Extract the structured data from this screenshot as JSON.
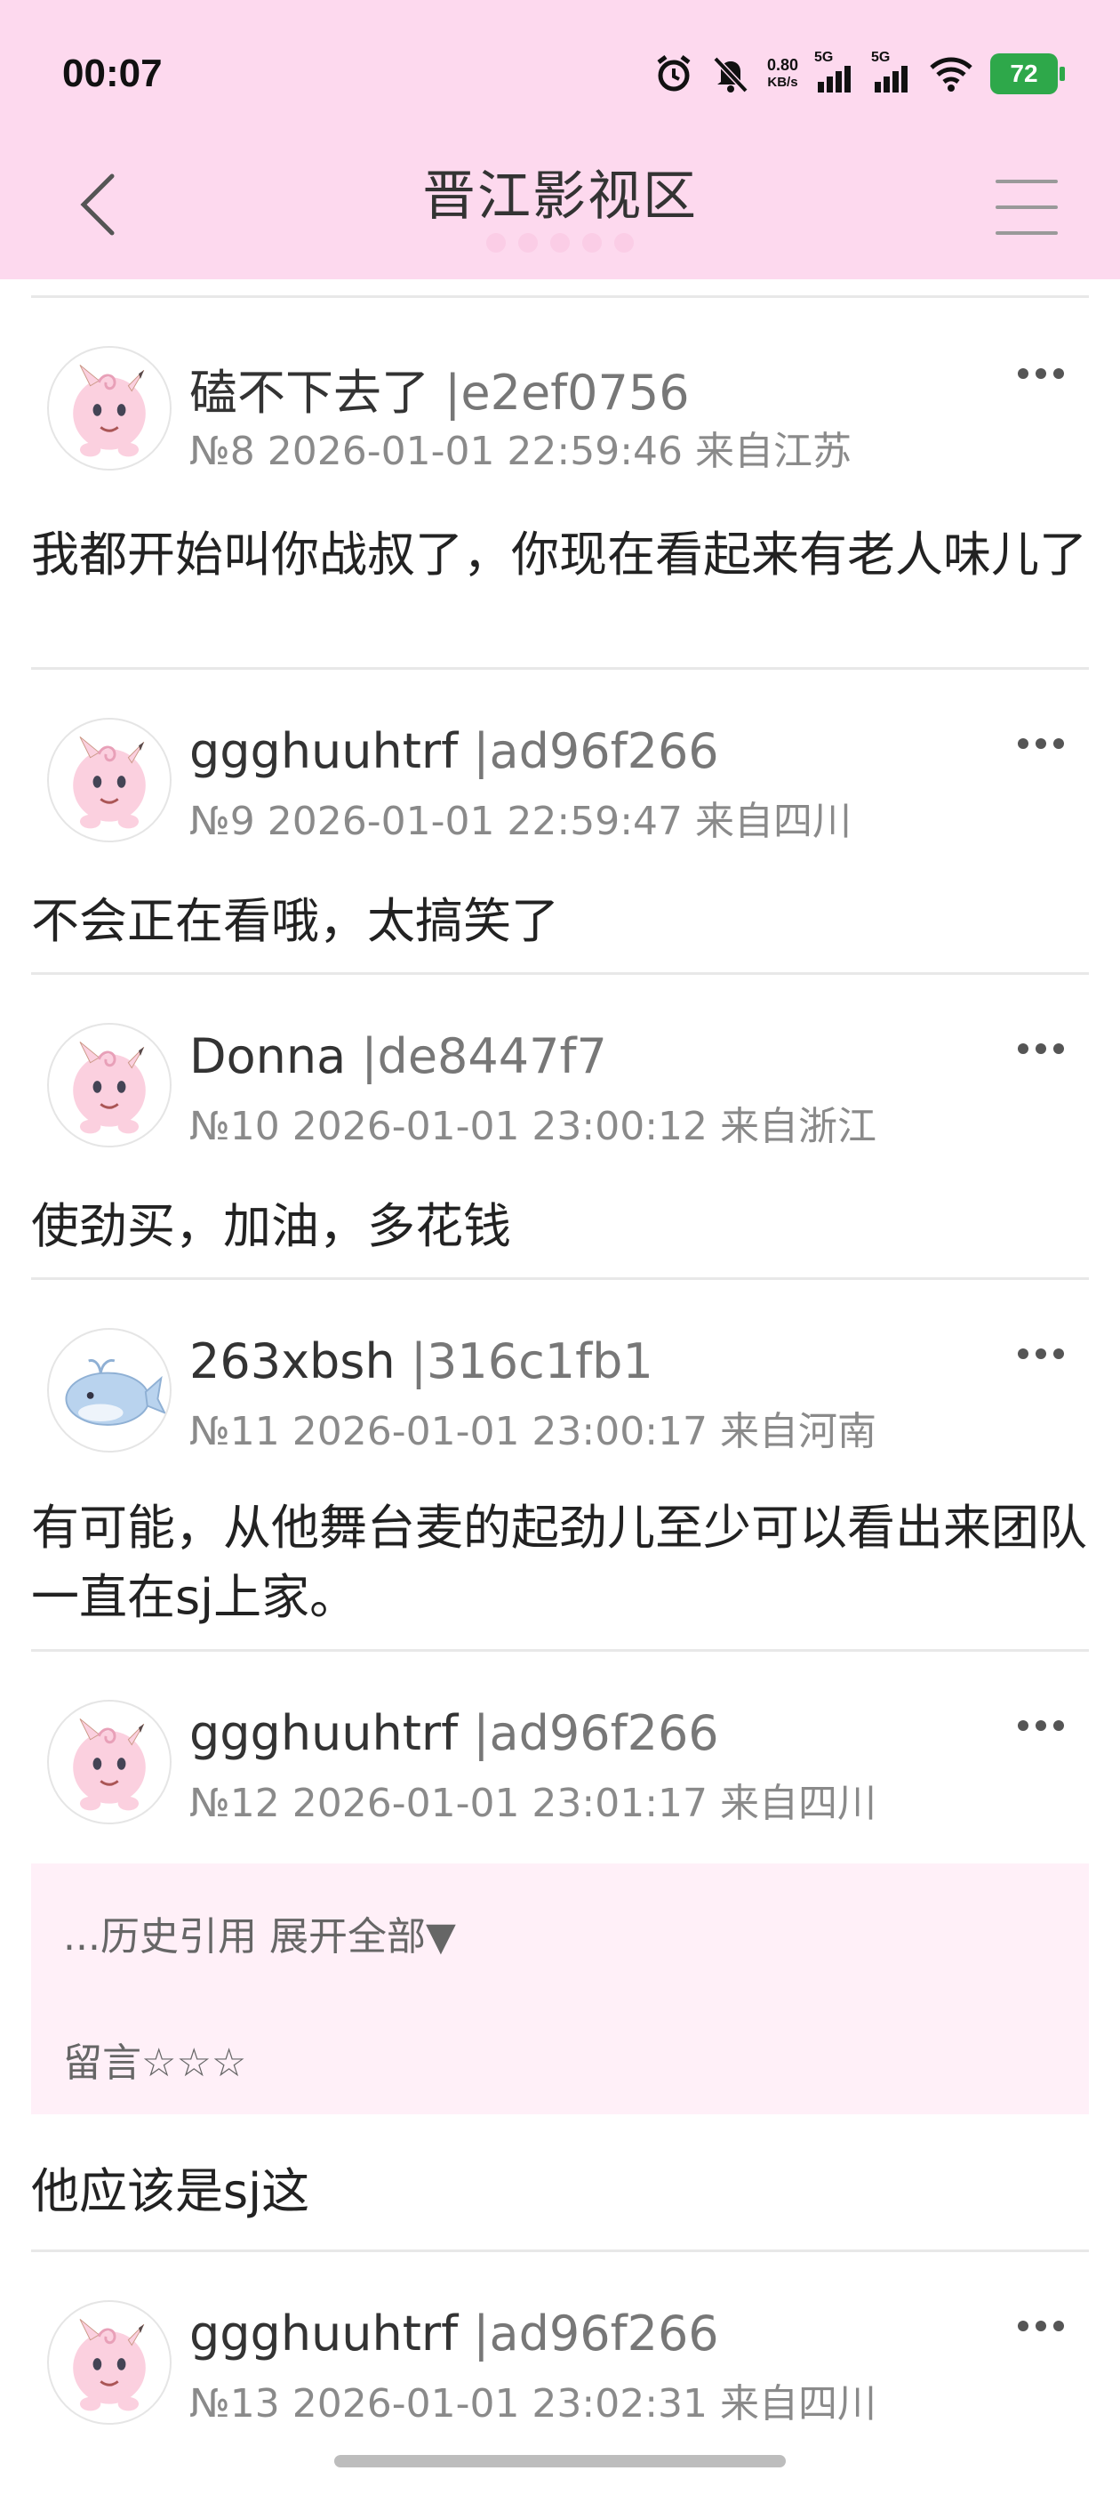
{
  "status_bar": {
    "time": "00:07",
    "net_speed_value": "0.80",
    "net_speed_unit": "KB/s",
    "sim1": "5G",
    "sim2": "5G",
    "battery": "72"
  },
  "header": {
    "title": "晋江影视区"
  },
  "posts": [
    {
      "name": "磕不下去了",
      "uid": "|e2ef0756",
      "meta": "№8 2026-01-01 22:59:46 来自江苏",
      "content": "我都开始叫你战叔了，你现在看起来有老人味儿了",
      "avatar": "pink-pokemon"
    },
    {
      "name": "ggghuuhtrf",
      "uid": "|ad96f266",
      "meta": "№9 2026-01-01 22:59:47 来自四川",
      "content": "不会正在看哦，太搞笑了",
      "avatar": "pink-pokemon"
    },
    {
      "name": "Donna",
      "uid": "|de8447f7",
      "meta": "№10 2026-01-01 23:00:12 来自浙江",
      "content": "使劲买，加油，多花钱",
      "avatar": "pink-pokemon"
    },
    {
      "name": "263xbsh",
      "uid": "|316c1fb1",
      "meta": "№11 2026-01-01 23:00:17 来自河南",
      "content": "有可能，从他舞台麦的起劲儿至少可以看出来团队一直在sj上家。",
      "avatar": "blue-whale"
    },
    {
      "name": "ggghuuhtrf",
      "uid": "|ad96f266",
      "meta": "№12 2026-01-01 23:01:17 来自四川",
      "quote_line1": "...历史引用 展开全部▼",
      "quote_line2": "留言☆☆☆",
      "content": "他应该是sj这",
      "avatar": "pink-pokemon"
    },
    {
      "name": "ggghuuhtrf",
      "uid": "|ad96f266",
      "meta": "№13 2026-01-01 23:02:31 来自四川",
      "avatar": "pink-pokemon"
    }
  ],
  "colors": {
    "header_bg": "#fdd9ee",
    "quote_bg": "#fff0f8",
    "battery": "#2ea84a"
  }
}
